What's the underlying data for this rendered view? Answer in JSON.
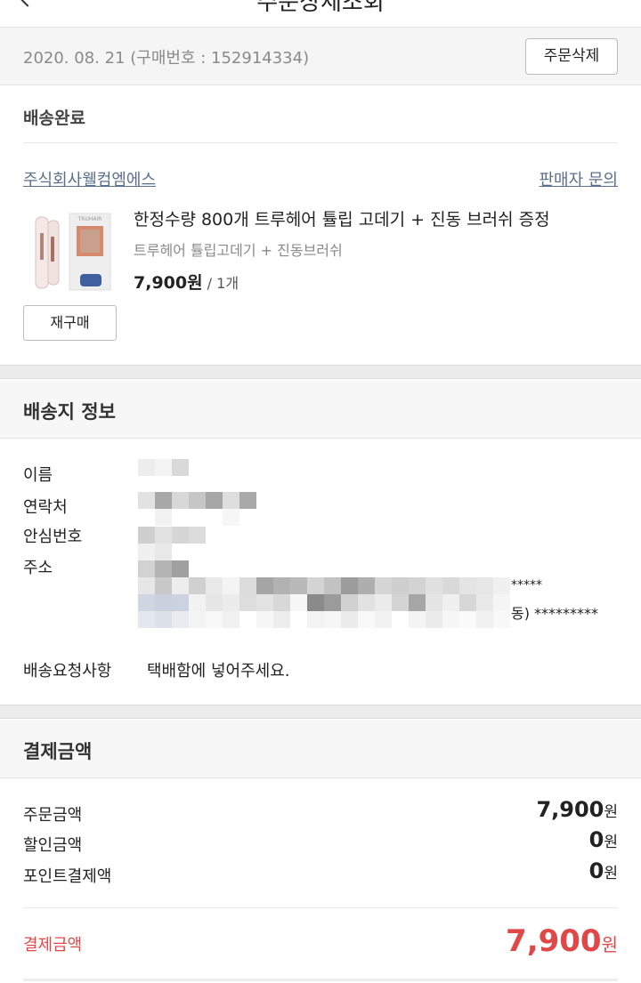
{
  "header": {
    "title": "주문상세조회"
  },
  "order": {
    "date": "2020. 08. 21",
    "number_label": "(구매번호 : 152914334)",
    "delete_label": "주문삭제"
  },
  "status": "배송완료",
  "seller": {
    "name": "주식회사웰컴엠에스",
    "inquiry_label": "판매자 문의"
  },
  "product": {
    "name": "한정수량 800개 트루헤어 튤립 고데기 + 진동 브러쉬 증정",
    "option": "트루헤어 튤립고데기 + 진동브러쉬",
    "price": "7,900",
    "currency": "원",
    "qty": " / 1개",
    "thumb_brand": "TRUHAIR",
    "rebuy_label": "재구매"
  },
  "shipping": {
    "title": "배송지 정보",
    "name_label": "이름",
    "contact_label": "연락처",
    "safe_label": "안심번호",
    "address_label": "주소",
    "address_mask_1": "*****",
    "address_mask_2": "동) *********",
    "request_label": "배송요청사항",
    "request_value": "택배함에 넣어주세요."
  },
  "payment": {
    "title": "결제금액",
    "rows": [
      {
        "label": "주문금액",
        "amount": "7,900",
        "unit": "원"
      },
      {
        "label": "할인금액",
        "amount": "0",
        "unit": "원"
      },
      {
        "label": "포인트결제액",
        "amount": "0",
        "unit": "원"
      }
    ],
    "total_label": "결제금액",
    "total_amount": "7,900",
    "total_unit": "원"
  },
  "colors": {
    "accent_red": "#e04848",
    "link_blue": "#5a6f8c"
  }
}
